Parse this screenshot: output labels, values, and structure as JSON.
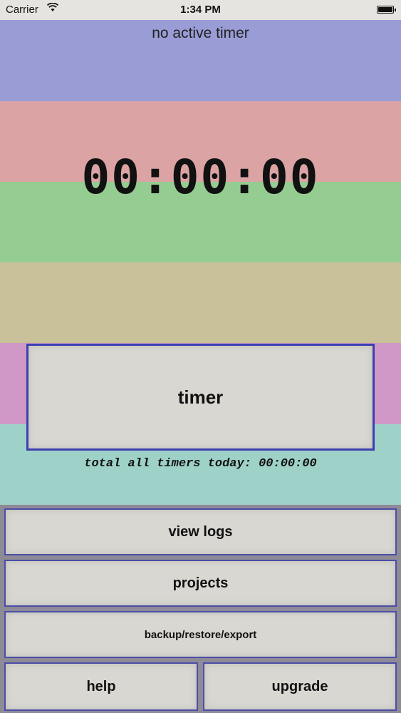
{
  "status_bar": {
    "carrier": "Carrier",
    "time": "1:34 PM",
    "wifi_icon": "wifi-icon",
    "battery_icon": "battery-icon",
    "battery_level": 1.0
  },
  "colors": {
    "band_blue": "#9a9cd6",
    "band_red": "#dba3a3",
    "band_green": "#95cc91",
    "band_tan": "#c8c199",
    "band_pink": "#cf98c6",
    "band_teal": "#9ed2c8",
    "border_accent": "#3c3fb2",
    "menu_background": "#8e8a96"
  },
  "header": {
    "active_timer_text": "no active timer"
  },
  "clock": {
    "display": "00:00:00"
  },
  "timer_button": {
    "label": "timer"
  },
  "summary": {
    "total_today_text": "total all timers today: 00:00:00"
  },
  "menu": {
    "view_logs": "view logs",
    "projects": "projects",
    "backup": "backup/restore/export",
    "help": "help",
    "upgrade": "upgrade"
  }
}
